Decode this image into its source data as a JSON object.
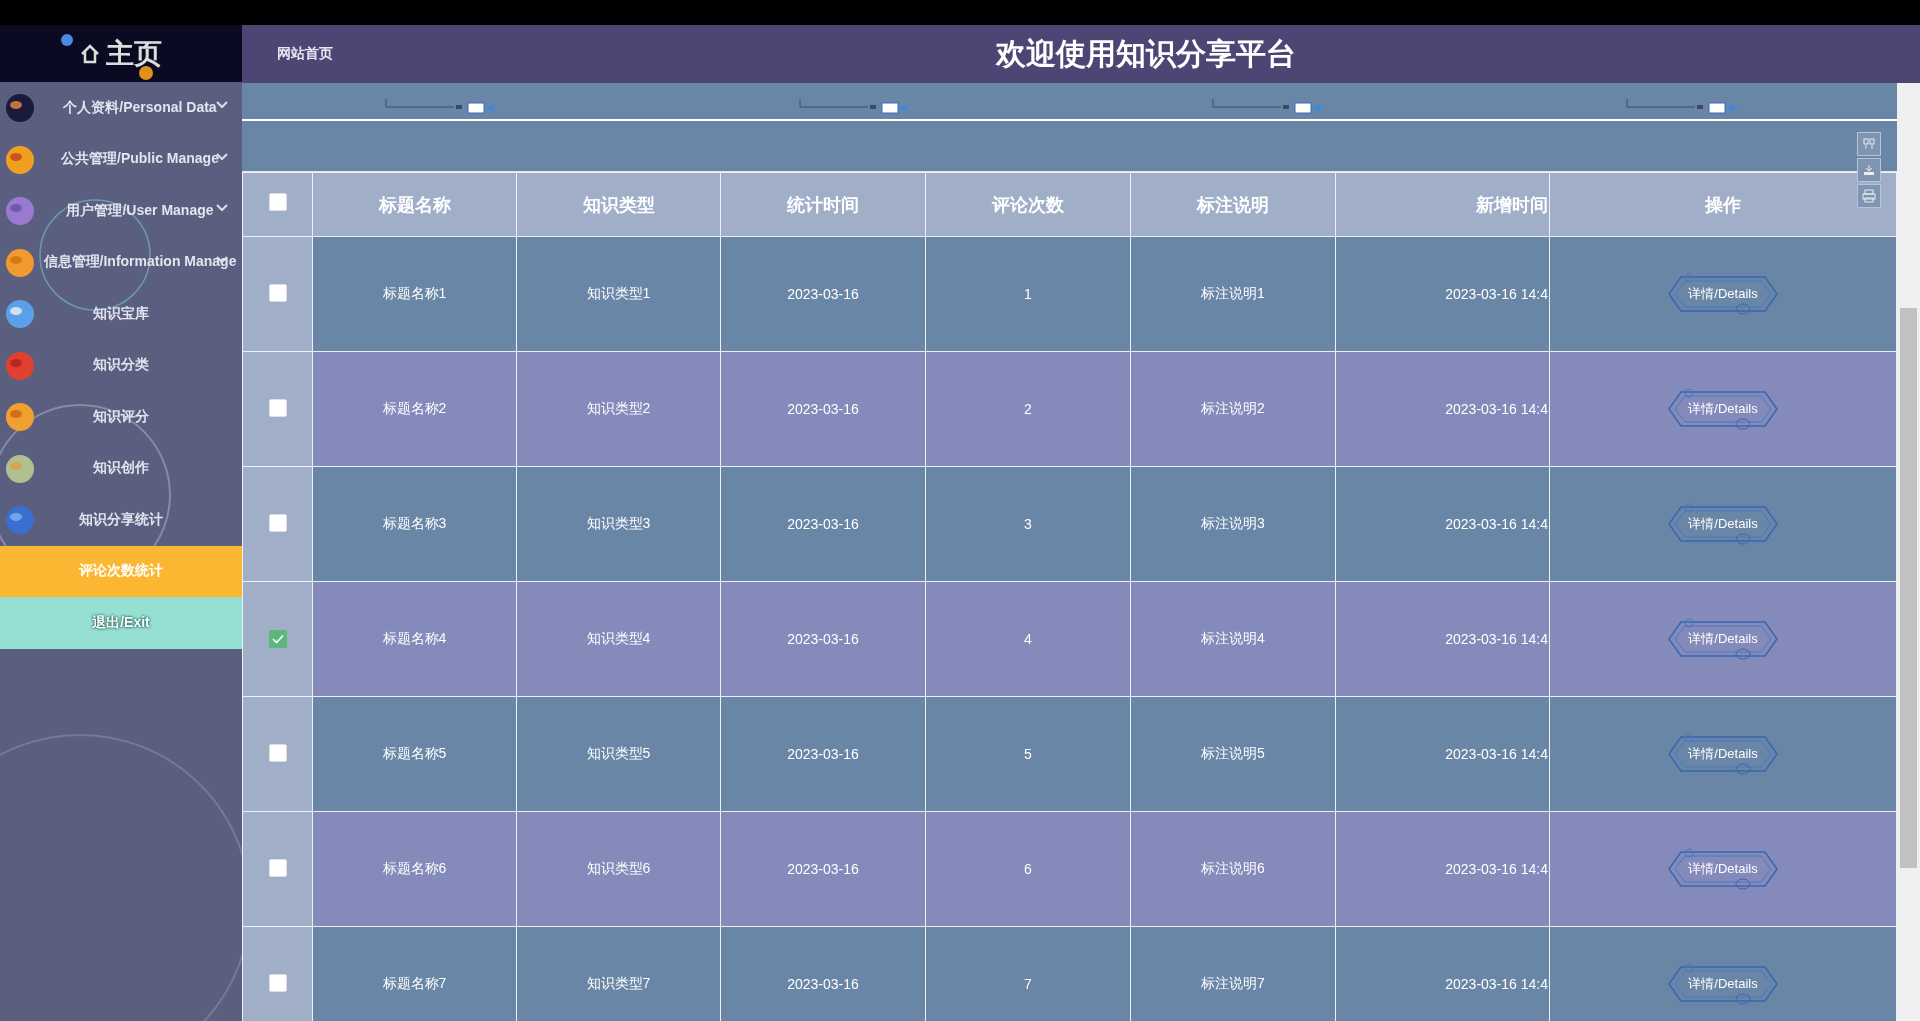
{
  "header": {
    "home_link": "网站首页",
    "title": "欢迎使用知识分享平台"
  },
  "sidebar": {
    "logo": "主页",
    "items": [
      {
        "kind": "group",
        "label": "个人资料/Personal Data",
        "selected": false
      },
      {
        "kind": "group",
        "label": "公共管理/Public Manage",
        "selected": false
      },
      {
        "kind": "group",
        "label": "用户管理/User Manage",
        "selected": false
      },
      {
        "kind": "group",
        "label": "信息管理/Information Manage",
        "selected": false
      },
      {
        "kind": "link",
        "label": "知识宝库",
        "selected": false
      },
      {
        "kind": "link",
        "label": "知识分类",
        "selected": false
      },
      {
        "kind": "link",
        "label": "知识评分",
        "selected": false
      },
      {
        "kind": "link",
        "label": "知识创作",
        "selected": false
      },
      {
        "kind": "link",
        "label": "知识分享统计",
        "selected": false
      },
      {
        "kind": "link",
        "label": "评论次数统计",
        "selected": true
      },
      {
        "kind": "exit",
        "label": "退出/Exit",
        "selected": false
      }
    ]
  },
  "table": {
    "select_all_checked": false,
    "columns": [
      "标题名称",
      "知识类型",
      "统计时间",
      "评论次数",
      "标注说明",
      "新增时间",
      "操作"
    ],
    "rows": [
      {
        "checked": false,
        "cells": [
          "标题名称1",
          "知识类型1",
          "2023-03-16",
          "1",
          "标注说明1",
          "2023-03-16 14:4"
        ],
        "action": "详情/Details"
      },
      {
        "checked": false,
        "cells": [
          "标题名称2",
          "知识类型2",
          "2023-03-16",
          "2",
          "标注说明2",
          "2023-03-16 14:4"
        ],
        "action": "详情/Details"
      },
      {
        "checked": false,
        "cells": [
          "标题名称3",
          "知识类型3",
          "2023-03-16",
          "3",
          "标注说明3",
          "2023-03-16 14:4"
        ],
        "action": "详情/Details"
      },
      {
        "checked": true,
        "cells": [
          "标题名称4",
          "知识类型4",
          "2023-03-16",
          "4",
          "标注说明4",
          "2023-03-16 14:4"
        ],
        "action": "详情/Details"
      },
      {
        "checked": false,
        "cells": [
          "标题名称5",
          "知识类型5",
          "2023-03-16",
          "5",
          "标注说明5",
          "2023-03-16 14:4"
        ],
        "action": "详情/Details"
      },
      {
        "checked": false,
        "cells": [
          "标题名称6",
          "知识类型6",
          "2023-03-16",
          "6",
          "标注说明6",
          "2023-03-16 14:4"
        ],
        "action": "详情/Details"
      },
      {
        "checked": false,
        "cells": [
          "标题名称7",
          "知识类型7",
          "2023-03-16",
          "7",
          "标注说明7",
          "2023-03-16 14:4"
        ],
        "action": "详情/Details"
      }
    ]
  }
}
